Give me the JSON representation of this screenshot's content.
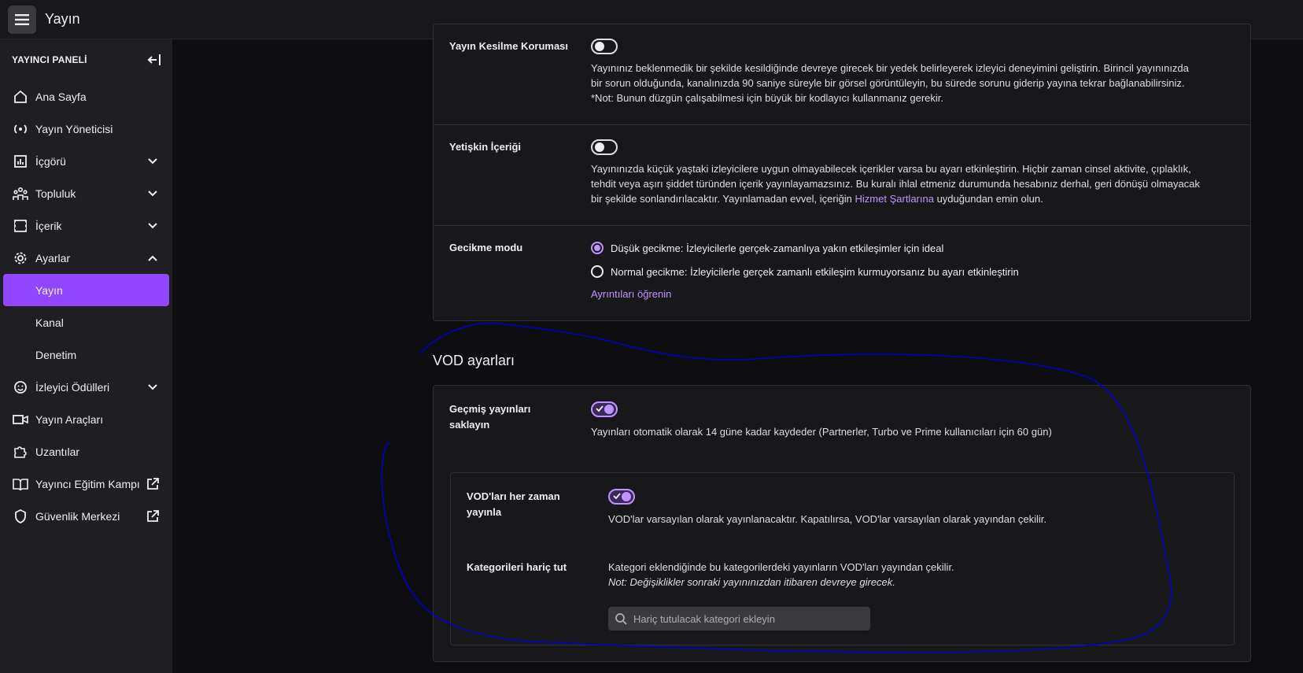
{
  "topbar": {
    "title": "Yayın"
  },
  "sidebar": {
    "heading": "YAYINCI PANELİ",
    "items": [
      {
        "label": "Ana Sayfa"
      },
      {
        "label": "Yayın Yöneticisi"
      },
      {
        "label": "İçgörü"
      },
      {
        "label": "Topluluk"
      },
      {
        "label": "İçerik"
      },
      {
        "label": "Ayarlar"
      },
      {
        "label": "İzleyici Ödülleri"
      },
      {
        "label": "Yayın Araçları"
      },
      {
        "label": "Uzantılar"
      },
      {
        "label": "Yayıncı Eğitim Kampı"
      },
      {
        "label": "Güvenlik Merkezi"
      }
    ],
    "sub_items": [
      {
        "label": "Yayın"
      },
      {
        "label": "Kanal"
      },
      {
        "label": "Denetim"
      }
    ]
  },
  "stream_settings": {
    "disconnect_protection": {
      "label": "Yayın Kesilme Koruması",
      "desc_1": "Yayınınız beklenmedik bir şekilde kesildiğinde devreye girecek bir yedek belirleyerek izleyici deneyimini geliştirin. Birincil yayınınızda",
      "desc_2": "bir sorun olduğunda, kanalınızda 90 saniye süreyle bir görsel görüntüleyin, bu sürede sorunu giderip yayına tekrar bağlanabilirsiniz.",
      "desc_3": "*Not: Bunun düzgün çalışabilmesi için büyük bir kodlayıcı kullanmanız gerekir."
    },
    "mature_content": {
      "label": "Yetişkin İçeriği",
      "desc_1": "Yayınınızda küçük yaştaki izleyicilere uygun olmayabilecek içerikler varsa bu ayarı etkinleştirin. Hiçbir zaman cinsel aktivite, çıplaklık,",
      "desc_2": "tehdit veya aşırı şiddet türünden içerik yayınlayamazsınız. Bu kuralı ihlal etmeniz durumunda hesabınız derhal, geri dönüşü olmayacak",
      "desc_3": "bir şekilde sonlandırılacaktır. Yayınlamadan evvel, içeriğin ",
      "link": "Hizmet Şartlarına",
      "desc_4": " uyduğundan emin olun."
    },
    "latency": {
      "label": "Gecikme modu",
      "low": "Düşük gecikme: İzleyicilerle gerçek-zamanlıya yakın etkileşimler için ideal",
      "normal": "Normal gecikme: İzleyicilerle gerçek zamanlı etkileşim kurmuyorsanız bu ayarı etkinleştirin",
      "learn_more": "Ayrıntıları öğrenin"
    }
  },
  "vod": {
    "title": "VOD ayarları",
    "store_past": {
      "label_1": "Geçmiş yayınları",
      "label_2": "saklayın",
      "desc": "Yayınları otomatik olarak 14 güne kadar kaydeder (Partnerler, Turbo ve Prime kullanıcıları için 60 gün)"
    },
    "always_publish": {
      "label_1": "VOD'ları her zaman",
      "label_2": "yayınla",
      "desc": "VOD'lar varsayılan olarak yayınlanacaktır. Kapatılırsa, VOD'lar varsayılan olarak yayından çekilir."
    },
    "exclude_categories": {
      "label": "Kategorileri hariç tut",
      "desc": "Kategori eklendiğinde bu kategorilerdeki yayınların VOD'ları yayından çekilir.",
      "note": "Not: Değişiklikler sonraki yayınınızdan itibaren devreye girecek.",
      "placeholder": "Hariç tutulacak kategori ekleyin"
    }
  },
  "colors": {
    "accent": "#9147ff",
    "accent_light": "#bf94ff",
    "annotation": "#0000cc"
  }
}
